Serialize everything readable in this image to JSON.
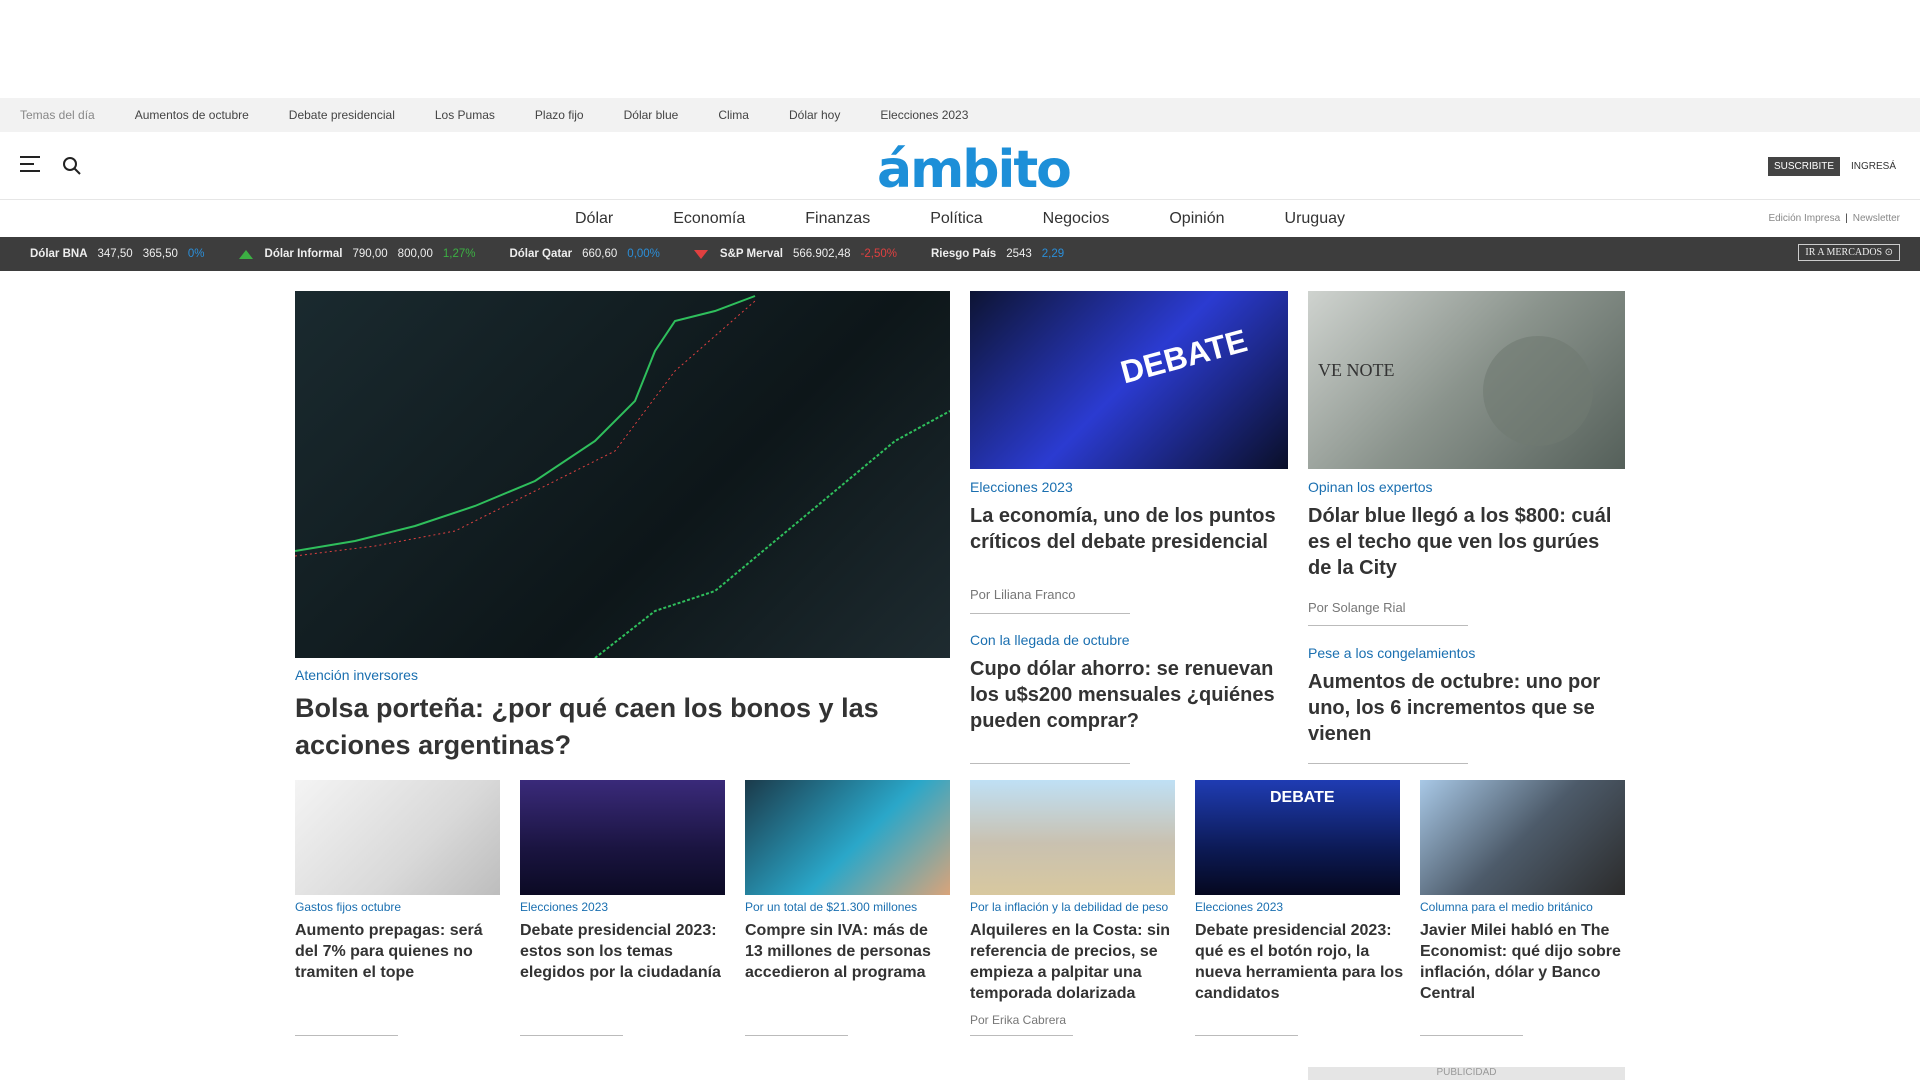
{
  "topics": {
    "label": "Temas del día",
    "items": [
      "Aumentos de octubre",
      "Debate presidencial",
      "Los Pumas",
      "Plazo fijo",
      "Dólar blue",
      "Clima",
      "Dólar hoy",
      "Elecciones 2023"
    ]
  },
  "header": {
    "logo": "ámbito",
    "subscribe": "SUSCRIBITE",
    "login": "INGRESÁ"
  },
  "nav": {
    "items": [
      "Dólar",
      "Economía",
      "Finanzas",
      "Política",
      "Negocios",
      "Opinión",
      "Uruguay"
    ],
    "print_edition": "Edición Impresa",
    "newsletter": "Newsletter"
  },
  "ticker": {
    "items": [
      {
        "name": "Dólar BNA",
        "buy": "347,50",
        "sell": "365,50",
        "change": "0%",
        "trend": "neutral"
      },
      {
        "name": "Dólar Informal",
        "buy": "790,00",
        "sell": "800,00",
        "change": "1,27%",
        "trend": "up"
      },
      {
        "name": "Dólar Qatar",
        "buy": "660,60",
        "sell": "",
        "change": "0,00%",
        "trend": "neutral"
      },
      {
        "name": "S&P Merval",
        "buy": "566.902,48",
        "sell": "",
        "change": "-2,50%",
        "trend": "down"
      },
      {
        "name": "Riesgo País",
        "buy": "2543",
        "sell": "",
        "change": "2,29",
        "trend": "neutral"
      }
    ],
    "markets_button": "IR A MERCADOS"
  },
  "articles": {
    "main": {
      "category": "Atención inversores",
      "title": "Bolsa porteña: ¿por qué caen los bonos y las acciones argentinas?"
    },
    "a1": {
      "category": "Elecciones 2023",
      "title": "La economía, uno de los puntos críticos del debate presidencial",
      "author": "Por Liliana Franco"
    },
    "a2": {
      "category": "Opinan los expertos",
      "title": "Dólar blue llegó a los $800: cuál es el techo que ven los gurúes de la City",
      "author": "Por Solange Rial"
    },
    "a3": {
      "category": "Con la llegada de octubre",
      "title": "Cupo dólar ahorro: se renuevan los u$s200 mensuales ¿quiénes pueden comprar?"
    },
    "a4": {
      "category": "Pese a los congelamientos",
      "title": "Aumentos de octubre: uno por uno, los 6 incrementos que se vienen"
    },
    "s1": {
      "category": "Gastos fijos octubre",
      "title": "Aumento prepagas: será del 7% para quienes no tramiten el tope"
    },
    "s2": {
      "category": "Elecciones 2023",
      "title": "Debate presidencial 2023: estos son los temas elegidos por la ciudadanía"
    },
    "s3": {
      "category": "Por un total de $21.300 millones",
      "title": "Compre sin IVA: más de 13 millones de personas accedieron al programa"
    },
    "s4": {
      "category": "Por la inflación y la debilidad de peso",
      "title": "Alquileres en la Costa: sin referencia de precios, se empieza a palpitar una temporada dolarizada",
      "author": "Por Erika Cabrera"
    },
    "s5": {
      "category": "Elecciones 2023",
      "title": "Debate presidencial 2023: qué es el botón rojo, la nueva herramienta para los candidatos"
    },
    "s6": {
      "category": "Columna para el medio británico",
      "title": "Javier Milei habló en The Economist: qué dijo sobre inflación, dólar y Banco Central"
    }
  },
  "ad_label": "PUBLICIDAD",
  "colors": {
    "brand": "#1d8fd8",
    "category": "#1a6fb0",
    "ticker_bg": "#3d3d3d",
    "up": "#3cb043",
    "down": "#e04040"
  }
}
